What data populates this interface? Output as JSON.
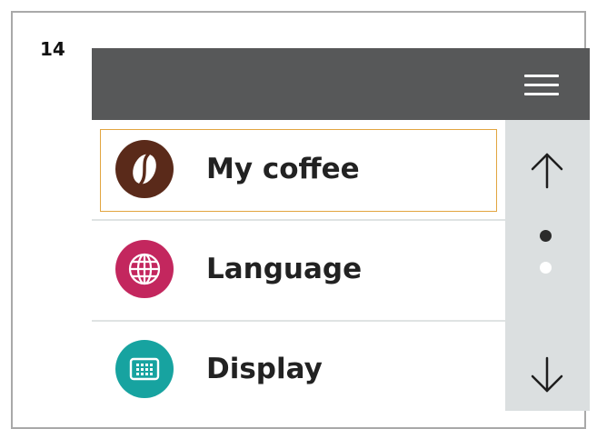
{
  "page": {
    "number": "14"
  },
  "header": {
    "menu_icon": "hamburger-menu-icon",
    "background": "#575859"
  },
  "menu": {
    "items": [
      {
        "label": "My coffee",
        "icon": "coffee-bean-icon",
        "icon_color": "#5a2a1a",
        "selected": true
      },
      {
        "label": "Language",
        "icon": "globe-icon",
        "icon_color": "#c3275e",
        "selected": false
      },
      {
        "label": "Display",
        "icon": "display-icon",
        "icon_color": "#17a3a0",
        "selected": false
      }
    ]
  },
  "scrollbar": {
    "up_icon": "arrow-up-icon",
    "down_icon": "arrow-down-icon",
    "pages": 2,
    "current_page": 1
  },
  "colors": {
    "selection_border": "#e2a540",
    "scroll_track": "#dbdfe0"
  }
}
